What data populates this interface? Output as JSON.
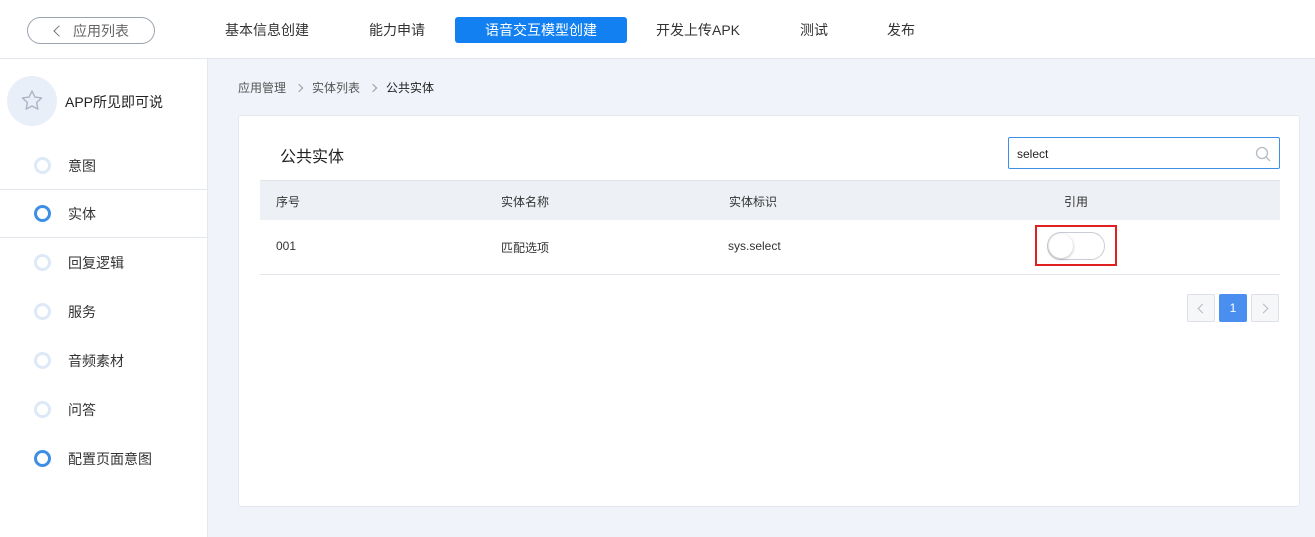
{
  "header": {
    "back_label": "应用列表",
    "tabs": [
      {
        "label": "基本信息创建"
      },
      {
        "label": "能力申请"
      },
      {
        "label": "语音交互模型创建",
        "active": true
      },
      {
        "label": "开发上传APK"
      },
      {
        "label": "测试"
      },
      {
        "label": "发布"
      }
    ]
  },
  "sidebar": {
    "app_name": "APP所见即可说",
    "items": [
      {
        "label": "意图"
      },
      {
        "label": "实体",
        "active": true
      },
      {
        "label": "回复逻辑"
      },
      {
        "label": "服务"
      },
      {
        "label": "音频素材"
      },
      {
        "label": "问答"
      },
      {
        "label": "配置页面意图"
      }
    ]
  },
  "breadcrumb": [
    "应用管理",
    "实体列表",
    "公共实体"
  ],
  "main": {
    "title": "公共实体",
    "search_value": "select",
    "columns": [
      "序号",
      "实体名称",
      "实体标识",
      "引用"
    ],
    "rows": [
      {
        "index": "001",
        "name": "匹配选项",
        "identifier": "sys.select",
        "referenced": false
      }
    ],
    "pagination": {
      "current_page": "1"
    }
  },
  "colors": {
    "accent": "#1280f0",
    "highlight": "#e02020"
  }
}
